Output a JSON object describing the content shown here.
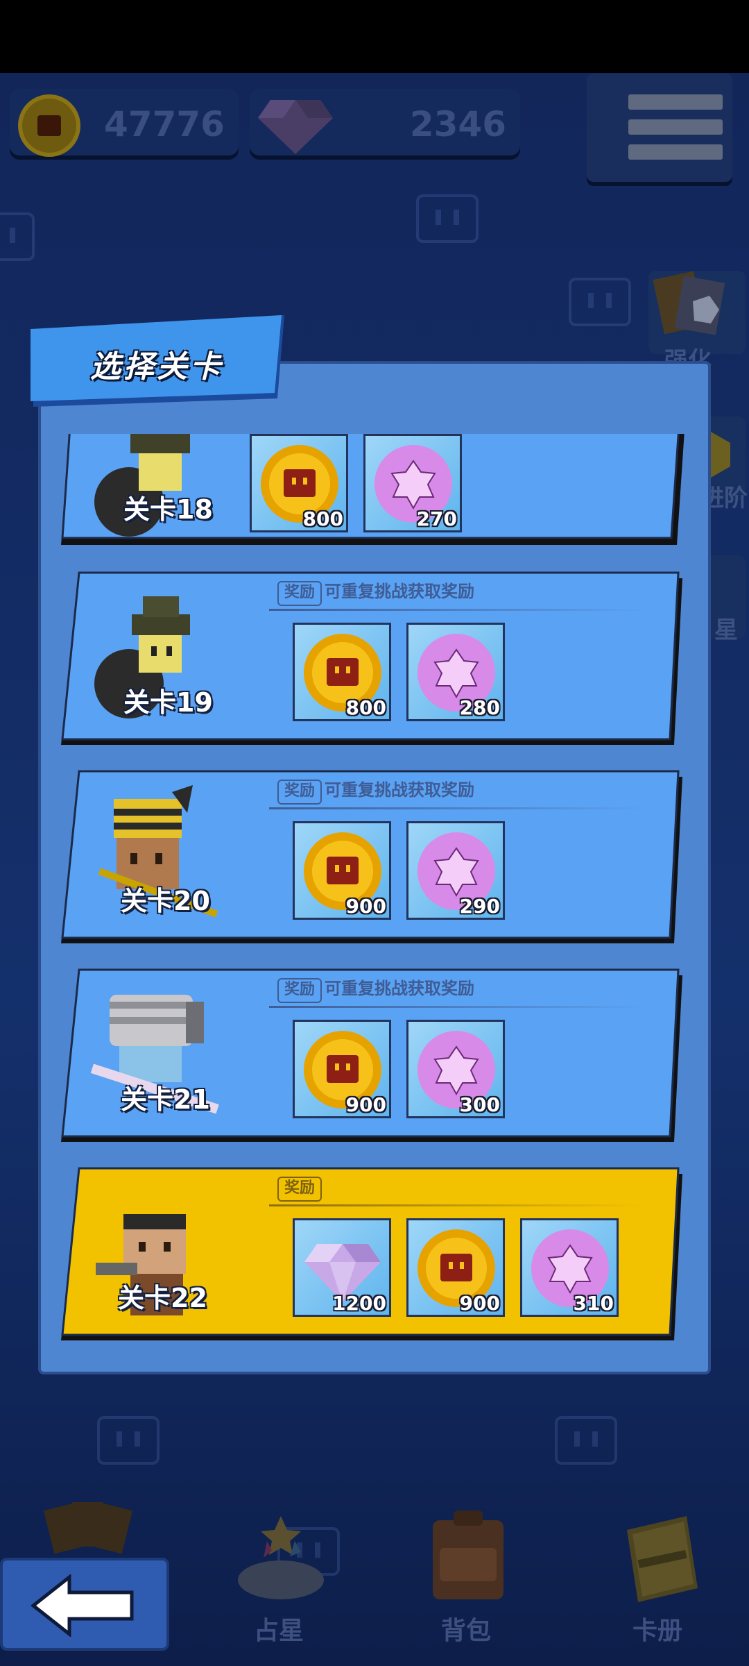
{
  "currency": {
    "coins": "47776",
    "gems": "2346",
    "coin_icon": "coin-icon",
    "gem_icon": "diamond-icon"
  },
  "menu": {
    "icon": "hamburger-menu-icon"
  },
  "side_buttons": [
    {
      "label": "强化"
    },
    {
      "label": "进阶"
    },
    {
      "label": "星"
    }
  ],
  "panel": {
    "title": "选择关卡"
  },
  "levels": [
    {
      "name": "关卡18",
      "reward_tag": "",
      "reward_desc": "",
      "rewards": [
        {
          "icon": "coin-icon",
          "amount": "800"
        },
        {
          "icon": "pink-orb-icon",
          "amount": "270"
        }
      ]
    },
    {
      "name": "关卡19",
      "reward_tag": "奖励",
      "reward_desc": "可重复挑战获取奖励",
      "rewards": [
        {
          "icon": "coin-icon",
          "amount": "800"
        },
        {
          "icon": "pink-orb-icon",
          "amount": "280"
        }
      ]
    },
    {
      "name": "关卡20",
      "reward_tag": "奖励",
      "reward_desc": "可重复挑战获取奖励",
      "rewards": [
        {
          "icon": "coin-icon",
          "amount": "900"
        },
        {
          "icon": "pink-orb-icon",
          "amount": "290"
        }
      ]
    },
    {
      "name": "关卡21",
      "reward_tag": "奖励",
      "reward_desc": "可重复挑战获取奖励",
      "rewards": [
        {
          "icon": "coin-icon",
          "amount": "900"
        },
        {
          "icon": "pink-orb-icon",
          "amount": "300"
        }
      ]
    },
    {
      "name": "关卡22",
      "reward_tag": "奖励",
      "reward_desc": "",
      "rewards": [
        {
          "icon": "diamond-icon",
          "amount": "1200"
        },
        {
          "icon": "coin-icon",
          "amount": "900"
        },
        {
          "icon": "pink-orb-icon",
          "amount": "310"
        }
      ]
    }
  ],
  "bottom_nav": [
    {
      "label": "",
      "icon": "back-arrow-icon"
    },
    {
      "label": "占星",
      "icon": "astrology-icon"
    },
    {
      "label": "背包",
      "icon": "backpack-icon"
    },
    {
      "label": "卡册",
      "icon": "card-album-icon"
    }
  ],
  "colors": {
    "card_blue": "#5aa2f4",
    "card_gold": "#f2c200",
    "panel": "#4f86d2",
    "background": "#12265a"
  }
}
